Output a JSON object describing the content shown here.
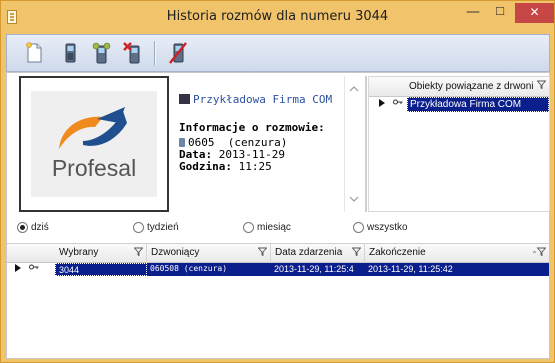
{
  "window": {
    "title": "Historia rozmów dla numeru 3044",
    "minimize_glyph": "—",
    "maximize_glyph": "☐",
    "close_glyph": "✕",
    "title_color": "#f1c36a",
    "close_color": "#c74646"
  },
  "toolbar": {
    "buttons": [
      {
        "icon": "new-document-icon"
      },
      {
        "icon": "phone-icon"
      },
      {
        "icon": "phone-group-icon"
      },
      {
        "icon": "phone-delete-icon"
      },
      {
        "icon": "phone-disabled-icon"
      }
    ]
  },
  "contact": {
    "logo_text": "Profesal",
    "company_link": "Przykładowa Firma COM",
    "call_info_heading": "Informacje o rozmowie:",
    "phone_number": "0605",
    "phone_note": "(cenzura)",
    "date_label": "Data:",
    "date_value": "2013-11-29",
    "time_label": "Godzina:",
    "time_value": "11:25"
  },
  "related_objects": {
    "header": "Obiekty powiązane z drwoni",
    "rows": [
      {
        "name": "Przykładowa Firma COM"
      }
    ]
  },
  "period_filter": {
    "options": [
      "dziś",
      "tydzień",
      "miesiąc",
      "wszystko"
    ],
    "selected": "dziś"
  },
  "calls_table": {
    "columns": [
      "Wybrany",
      "Dzwoniący",
      "Data zdarzenia",
      "Zakończenie"
    ],
    "rows": [
      {
        "wybrany": "3044",
        "dzwoniacy": "060508 (cenzura)",
        "data_zdarzenia": "2013-11-29, 11:25:4",
        "zakonczenie": "2013-11-29, 11:25:42"
      }
    ],
    "selection_color": "#0a1e8c"
  }
}
